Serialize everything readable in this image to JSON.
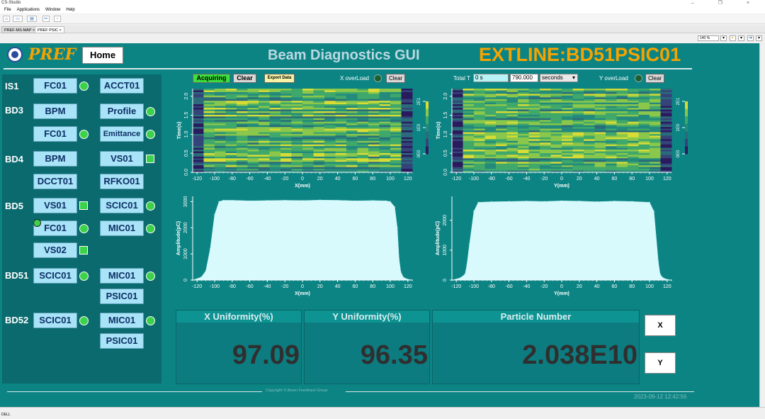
{
  "window": {
    "title": "CS-Studio",
    "controls": "– ❐ ×"
  },
  "menu": [
    "File",
    "Applications",
    "Window",
    "Help"
  ],
  "tabs": [
    {
      "label": "PREF-MS-MAP ×",
      "active": false
    },
    {
      "label": "PREF PSIC ×",
      "active": true
    }
  ],
  "zoom": "140 %",
  "header": {
    "brand": "PREF",
    "home": "Home",
    "app_title": "Beam Diagnostics GUI",
    "pv_title": "EXTLINE:BD51PSIC01"
  },
  "groups": [
    "IS1",
    "BD3",
    "BD4",
    "BD5",
    "BD51",
    "BD52"
  ],
  "devices": {
    "is1_fc01": "FC01",
    "is1_acct01": "ACCT01",
    "bd3_bpm": "BPM",
    "bd3_profile": "Profile",
    "bd3_fc01": "FC01",
    "bd3_emittance": "Emittance",
    "bd4_bpm": "BPM",
    "bd4_vs01": "VS01",
    "bd4_dcct01": "DCCT01",
    "bd4_rfko01": "RFKO01",
    "bd5_vs01": "VS01",
    "bd5_scic01": "SCIC01",
    "bd5_fc01": "FC01",
    "bd5_mic01": "MIC01",
    "bd5_vs02": "VS02",
    "bd51_scic01": "SCIC01",
    "bd51_mic01": "MIC01",
    "bd51_psic01": "PSIC01",
    "bd52_scic01": "SCIC01",
    "bd52_mic01": "MIC01",
    "bd52_psic01": "PSIC01"
  },
  "controls": {
    "acquiring": "Acquiring",
    "clear": "Clear",
    "export": "Export Data",
    "x_overload": "X overLoad",
    "x_clear": "Clear",
    "total_t_label": "Total T",
    "total_t_value": "0 s",
    "period_value": "790.000",
    "unit": "seconds",
    "y_overload": "Y overLoad",
    "y_clear": "Clear"
  },
  "colors": {
    "background": "#0d8484",
    "accent": "#f4a300",
    "button": "#a8e3f7",
    "led_on": "#3cd24a"
  },
  "metrics": {
    "x_uniformity_label": "X Uniformity(%)",
    "x_uniformity": "97.09",
    "y_uniformity_label": "Y Uniformity(%)",
    "y_uniformity": "96.35",
    "particle_label": "Particle Number",
    "particle": "2.038E10"
  },
  "side_buttons": {
    "x": "X",
    "y": "Y"
  },
  "footer": {
    "copyright": "Copyright © Beam Feedback Group",
    "timestamp": "2023-09-12 12:42:56"
  },
  "status": "DELL",
  "chart_data": [
    {
      "type": "heatmap",
      "xlabel": "X(mm)",
      "ylabel": "Time(s)",
      "xlim": [
        -125,
        125
      ],
      "ylim": [
        0,
        2.2
      ],
      "xticks": [
        -120,
        -100,
        -80,
        -60,
        -40,
        -20,
        0,
        20,
        40,
        60,
        80,
        100,
        120
      ],
      "yticks": [
        0.0,
        0.5,
        1.0,
        1.5,
        2.0
      ],
      "colorbar_ticks": [
        "0E0",
        "1E0",
        "2E1"
      ]
    },
    {
      "type": "heatmap",
      "xlabel": "Y(mm)",
      "ylabel": "Time(s)",
      "xlim": [
        -125,
        125
      ],
      "ylim": [
        0,
        2.2
      ],
      "xticks": [
        -120,
        -100,
        -80,
        -60,
        -40,
        -20,
        0,
        20,
        40,
        60,
        80,
        100,
        120
      ],
      "yticks": [
        0.0,
        0.5,
        1.0,
        1.5,
        2.0
      ],
      "colorbar_ticks": [
        "0E0",
        "1E0",
        "2E1"
      ]
    },
    {
      "type": "bar",
      "xlabel": "X(mm)",
      "ylabel": "Amplitude(pC)",
      "xlim": [
        -125,
        125
      ],
      "ylim": [
        0,
        3200
      ],
      "xticks": [
        -120,
        -100,
        -80,
        -60,
        -40,
        -20,
        0,
        20,
        40,
        60,
        80,
        100,
        120
      ],
      "yticks": [
        0,
        1000,
        2000,
        3000
      ],
      "x": [
        -125,
        -120,
        -115,
        -110,
        -105,
        -100,
        -95,
        -90,
        -80,
        -60,
        -40,
        -20,
        0,
        20,
        40,
        60,
        80,
        95,
        100,
        105,
        108,
        110,
        112,
        115,
        120,
        125
      ],
      "values": [
        0,
        50,
        120,
        350,
        1200,
        2500,
        3000,
        3050,
        3050,
        3030,
        3040,
        3050,
        3040,
        3060,
        3050,
        3030,
        3040,
        3030,
        3000,
        2800,
        2000,
        800,
        300,
        100,
        30,
        0
      ]
    },
    {
      "type": "bar",
      "xlabel": "Y(mm)",
      "ylabel": "Amplitude(pC)",
      "xlim": [
        -125,
        125
      ],
      "ylim": [
        0,
        2800
      ],
      "xticks": [
        -120,
        -100,
        -80,
        -60,
        -40,
        -20,
        0,
        20,
        40,
        60,
        80,
        100,
        120
      ],
      "yticks": [
        0,
        1000,
        2000
      ],
      "x": [
        -125,
        -120,
        -115,
        -110,
        -108,
        -105,
        -100,
        -95,
        -80,
        -60,
        -40,
        -20,
        0,
        20,
        40,
        60,
        80,
        100,
        105,
        110,
        112,
        115,
        120,
        125
      ],
      "values": [
        0,
        30,
        80,
        200,
        500,
        1200,
        2300,
        2600,
        2620,
        2630,
        2640,
        2630,
        2650,
        2640,
        2620,
        2640,
        2630,
        2600,
        2300,
        600,
        200,
        80,
        20,
        0
      ]
    }
  ]
}
